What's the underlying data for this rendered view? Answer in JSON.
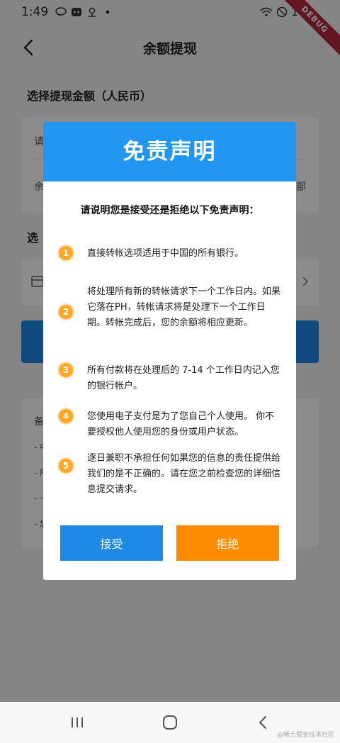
{
  "status_bar": {
    "time": "1:49",
    "battery": "100",
    "debug_label": "DEBUG",
    "icons": [
      "line-icon",
      "chat-icon",
      "location-icon",
      "dot-icon",
      "wifi-icon",
      "mute-icon"
    ]
  },
  "app_bar": {
    "title": "余额提现",
    "back_icon": "back-arrow-icon"
  },
  "background_page": {
    "section1_title": "选择提现金额（人民币）",
    "card1_row1": "请",
    "card1_row2_left": "余",
    "card1_row2_right": "部",
    "section2_title": "选",
    "note_label": "备",
    "note_lines": [
      "- 中",
      "- 所",
      "- 一",
      "- 您"
    ]
  },
  "dialog": {
    "title": "免责声明",
    "question": "请说明您是接受还是拒绝以下免责声明：",
    "items": [
      {
        "num": "1",
        "text": "直接转帐选项适用于中国的所有银行。"
      },
      {
        "num": "2",
        "text": "将处理所有新的转帐请求下一个工作日内。如果它落在PH，转帐请求将是处理下一个工作日期。转帐完成后，您的余额将相应更新。"
      },
      {
        "num": "3",
        "text": "所有付款将在处理后的 7-14 个工作日内记入您的银行帐户。"
      },
      {
        "num": "4",
        "text": "您使用电子支付是为了您自己个人使用。 你不要授权他人使用您的身份或用户状态。"
      },
      {
        "num": "5",
        "text": "逐日兼职不承担任何如果您的信息的责任提供给我们的是不正确的。请在您之前检查您的详细信息提交请求。"
      }
    ],
    "accept_label": "接受",
    "reject_label": "拒绝"
  },
  "nav_bar": {
    "recents_icon": "recents-icon",
    "home_icon": "home-icon",
    "back_icon": "back-icon"
  },
  "watermark": "@稀土掘金技术社区",
  "colors": {
    "header_blue": "#2196f3",
    "accept_blue": "#1e88e5",
    "reject_orange": "#fb8c00",
    "badge_orange": "#ffa726",
    "debug_red": "#b2283d"
  }
}
